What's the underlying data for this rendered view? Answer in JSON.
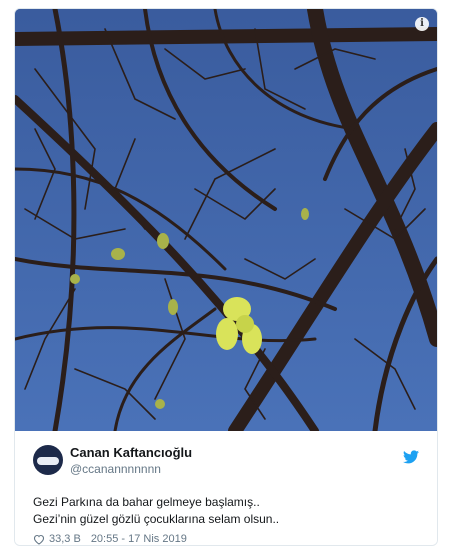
{
  "tweet": {
    "display_name": "Canan Kaftancıoğlu",
    "handle": "@ccanannnnnnn",
    "text_line1": "Gezi Parkına da bahar gelmeye başlamış..",
    "text_line2": "Gezi’nin güzel gözlü çocuklarına selam olsun..",
    "likes": "33,3 B",
    "timestamp": "20:55 - 17 Nis 2019"
  },
  "icons": {
    "info": "info-icon",
    "twitter": "twitter-bird-icon",
    "like": "heart-icon"
  },
  "colors": {
    "sky": "#3f63a8",
    "branches": "#2b1e1a",
    "leaves": "#d9e35a",
    "twitter_blue": "#1da1f2",
    "muted_text": "#657786"
  }
}
